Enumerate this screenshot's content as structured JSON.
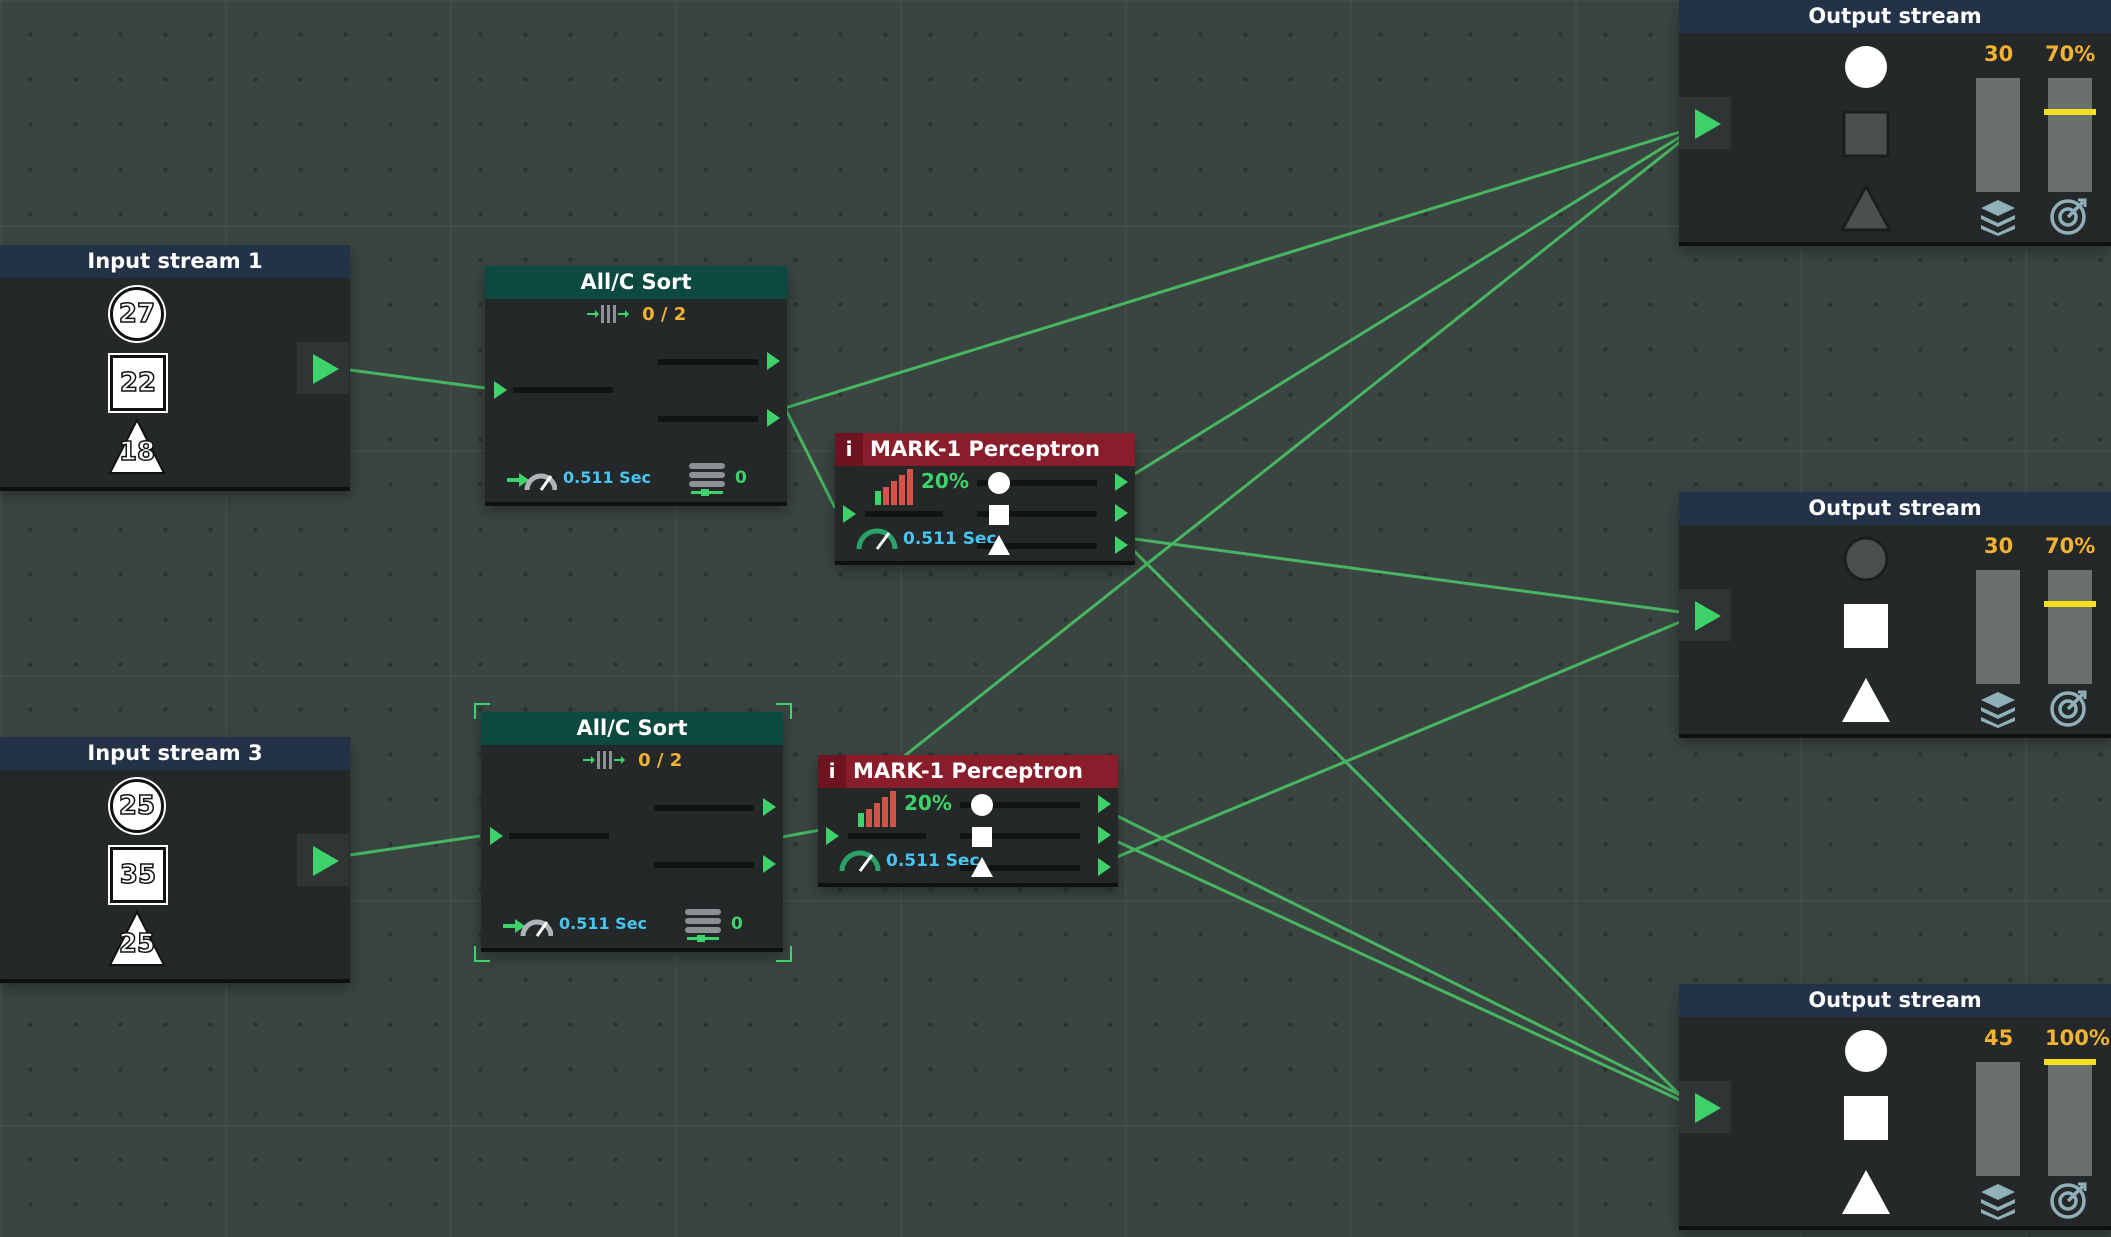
{
  "input_streams": [
    {
      "title": "Input stream 1",
      "circle": "27",
      "square": "22",
      "triangle": "18"
    },
    {
      "title": "Input stream 3",
      "circle": "25",
      "square": "35",
      "triangle": "25"
    }
  ],
  "sorters": [
    {
      "title": "All/C Sort",
      "capacity": "0 / 2",
      "speed": "0.511 Sec",
      "queue": "0"
    },
    {
      "title": "All/C Sort",
      "capacity": "0 / 2",
      "speed": "0.511 Sec",
      "queue": "0"
    }
  ],
  "perceptrons": [
    {
      "title": "MARK-1 Perceptron",
      "info": "i",
      "accuracy": "20%",
      "speed": "0.511 Sec"
    },
    {
      "title": "MARK-1 Perceptron",
      "info": "i",
      "accuracy": "20%",
      "speed": "0.511 Sec"
    }
  ],
  "output_streams": [
    {
      "title": "Output stream",
      "count": "30",
      "percent": "70%",
      "target_level": 0.7,
      "accepts": {
        "circle": true,
        "square": false,
        "triangle": false
      }
    },
    {
      "title": "Output stream",
      "count": "30",
      "percent": "70%",
      "target_level": 0.7,
      "accepts": {
        "circle": false,
        "square": true,
        "triangle": true
      }
    },
    {
      "title": "Output stream",
      "count": "45",
      "percent": "100%",
      "target_level": 1.0,
      "accepts": {
        "circle": true,
        "square": true,
        "triangle": true
      }
    }
  ],
  "colors": {
    "accent_green": "#3dd36a",
    "speed_cyan": "#48c4f0",
    "amber": "#f2b234",
    "target_yellow": "#f4e11b",
    "perceptron_red": "#8a1d2b",
    "sorter_teal": "#0c4a3f",
    "stream_blue": "#243247"
  },
  "icons": [
    "play-arrow-icon",
    "sorter-capacity-icon",
    "speed-gauge-icon",
    "queue-stack-icon",
    "accuracy-bars-icon",
    "layers-icon",
    "target-icon"
  ]
}
